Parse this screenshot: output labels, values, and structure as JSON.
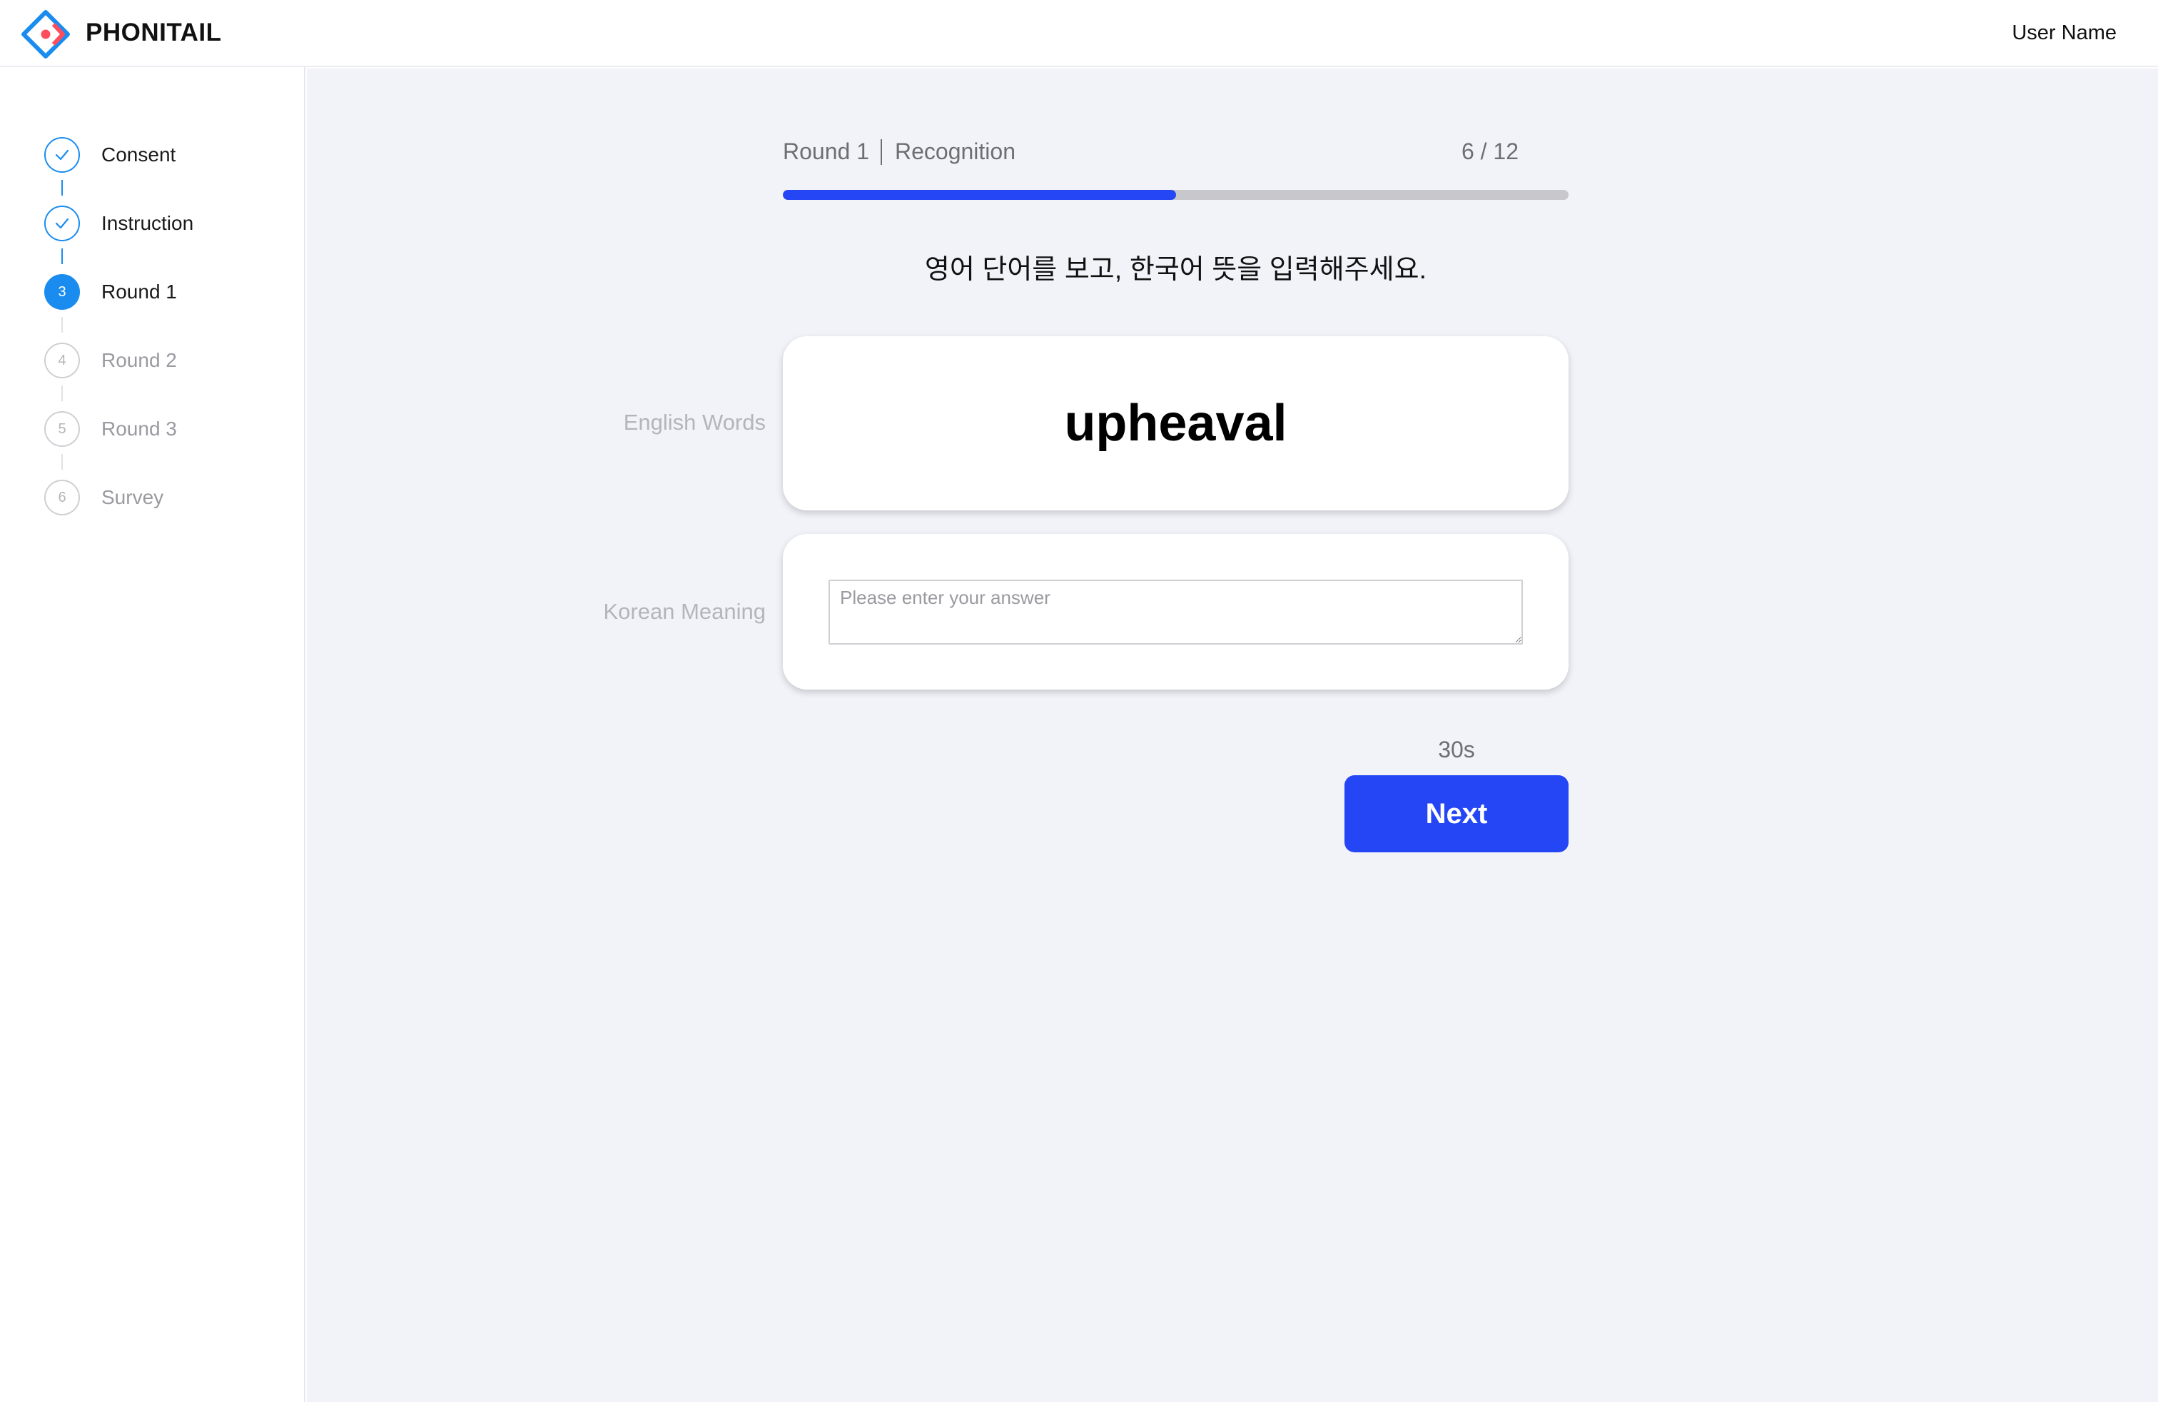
{
  "header": {
    "brand": "PHONITAIL",
    "user_name": "User Name",
    "logo_icon": "diamond-logo-icon"
  },
  "sidebar": {
    "steps": [
      {
        "number": "1",
        "label": "Consent",
        "status": "done"
      },
      {
        "number": "2",
        "label": "Instruction",
        "status": "done"
      },
      {
        "number": "3",
        "label": "Round 1",
        "status": "active"
      },
      {
        "number": "4",
        "label": "Round 2",
        "status": "todo"
      },
      {
        "number": "5",
        "label": "Round 3",
        "status": "todo"
      },
      {
        "number": "6",
        "label": "Survey",
        "status": "todo"
      }
    ]
  },
  "main": {
    "round": "Round 1",
    "phase": "Recognition",
    "counter": "6 / 12",
    "progress": 0.5,
    "instruction": "영어 단어를 보고, 한국어 뜻을 입력해주세요.",
    "word_label": "English Words",
    "word": "upheaval",
    "meaning_label": "Korean Meaning",
    "answer_placeholder": "Please enter your answer",
    "answer_value": "",
    "timer": "30s",
    "next_label": "Next"
  },
  "colors": {
    "accent": "#2446f5",
    "step_blue": "#1a8cf0",
    "background": "#f2f3f9"
  }
}
